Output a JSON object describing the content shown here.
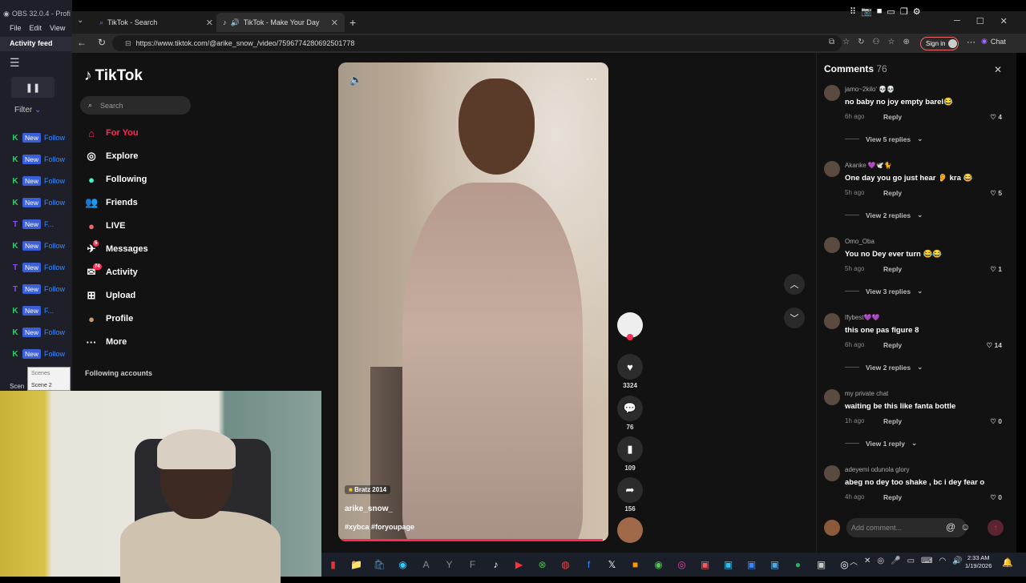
{
  "obs": {
    "title": "OBS 32.0.4 - Profi",
    "menu": [
      "File",
      "Edit",
      "View"
    ],
    "activity_feed": "Activity feed",
    "pause": "❚❚",
    "filter": "Filter",
    "feed": [
      {
        "icon": "K",
        "color": "#2bd36b",
        "badge": "New",
        "text": "Follow"
      },
      {
        "icon": "K",
        "color": "#2bd36b",
        "badge": "New",
        "text": "Follow"
      },
      {
        "icon": "K",
        "color": "#2bd36b",
        "badge": "New",
        "text": "Follow"
      },
      {
        "icon": "K",
        "color": "#2bd36b",
        "badge": "New",
        "text": "Follow"
      },
      {
        "icon": "T",
        "color": "#9146ff",
        "badge": "New",
        "text": "F..."
      },
      {
        "icon": "K",
        "color": "#2bd36b",
        "badge": "New",
        "text": "Follow"
      },
      {
        "icon": "T",
        "color": "#9146ff",
        "badge": "New",
        "text": "Follow"
      },
      {
        "icon": "T",
        "color": "#9146ff",
        "badge": "New",
        "text": "Follow"
      },
      {
        "icon": "K",
        "color": "#2bd36b",
        "badge": "New",
        "text": "F..."
      },
      {
        "icon": "K",
        "color": "#2bd36b",
        "badge": "New",
        "text": "Follow"
      },
      {
        "icon": "K",
        "color": "#2bd36b",
        "badge": "New",
        "text": "Follow"
      }
    ],
    "scene_label": "Scen",
    "scenes_popup": "Scenes",
    "scene_item": "Scene 2"
  },
  "browser": {
    "tabs": [
      {
        "title": "TikTok - Search"
      },
      {
        "title": "TikTok - Make Your Day"
      }
    ],
    "url": "https://www.tiktok.com/@arike_snow_/video/7596774280692501778",
    "signin": "Sign in",
    "chat": "Chat"
  },
  "tiktok": {
    "logo": "TikTok",
    "search_placeholder": "Search",
    "nav": [
      {
        "label": "For You",
        "icon": "⌂",
        "active": true
      },
      {
        "label": "Explore",
        "icon": "◎"
      },
      {
        "label": "Following",
        "icon": "●"
      },
      {
        "label": "Friends",
        "icon": "👥"
      },
      {
        "label": "LIVE",
        "icon": "●"
      },
      {
        "label": "Messages",
        "icon": "✈",
        "badge": "5"
      },
      {
        "label": "Activity",
        "icon": "✉",
        "badge": "74"
      },
      {
        "label": "Upload",
        "icon": "⊞"
      },
      {
        "label": "Profile",
        "icon": "●"
      },
      {
        "label": "More",
        "icon": "···"
      }
    ],
    "following_accounts": "Following accounts",
    "video": {
      "tag": "Bratz 2014",
      "author": "arike_snow_",
      "hashtags": "#xybca #foryoupage",
      "progress": 0.98
    },
    "actions": {
      "likes": "3324",
      "comments": "76",
      "saves": "109",
      "shares": "156"
    }
  },
  "comments": {
    "title": "Comments",
    "count": "76",
    "items": [
      {
        "user": "jamo~2kilo' 💀💀",
        "text": "no baby no joy empty barel😂",
        "time": "6h ago",
        "reply": "Reply",
        "likes": "4",
        "view": "View 5 replies"
      },
      {
        "user": "Akanke 💜🕊️🐈",
        "text": "One day you go just hear 👂 kra 😂",
        "time": "5h ago",
        "reply": "Reply",
        "likes": "5",
        "view": "View 2 replies"
      },
      {
        "user": "Omo_Oba",
        "text": "You no Dey ever turn 😂😂",
        "time": "5h ago",
        "reply": "Reply",
        "likes": "1",
        "view": "View 3 replies"
      },
      {
        "user": "Ifybest💜💜",
        "text": "this one pas figure 8",
        "time": "6h ago",
        "reply": "Reply",
        "likes": "14",
        "view": "View 2 replies"
      },
      {
        "user": "my private chat",
        "text": "waiting be this like fanta bottle",
        "time": "1h ago",
        "reply": "Reply",
        "likes": "0",
        "view": "View 1 reply"
      },
      {
        "user": "adeyemi odunola glory",
        "text": "abeg no dey too shake , bc i dey fear o",
        "time": "4h ago",
        "reply": "Reply",
        "likes": "0",
        "view": ""
      }
    ],
    "add_placeholder": "Add comment..."
  },
  "taskbar": {
    "time": "2:33 AM",
    "date": "1/19/2026"
  }
}
